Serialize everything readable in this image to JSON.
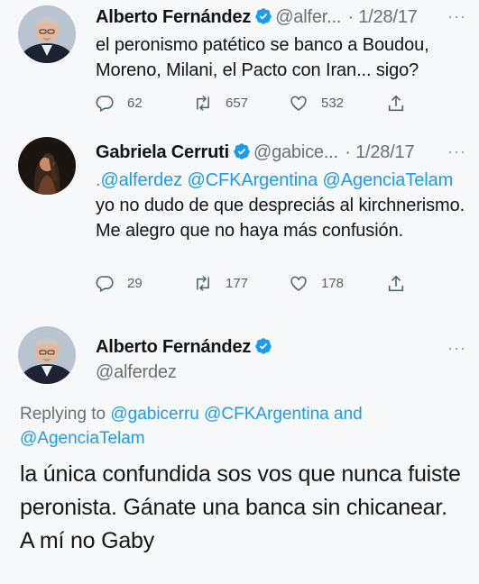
{
  "tweets": [
    {
      "name": "Alberto Fernández",
      "handle": "@alfer...",
      "date": "· 1/28/17",
      "more": "···",
      "text": "el peronismo patético se banco a Boudou, Moreno, Milani, el Pacto con Iran... sigo?",
      "reply_count": "62",
      "retweet_count": "657",
      "like_count": "532"
    },
    {
      "name": "Gabriela Cerruti",
      "handle": "@gabice...",
      "date": "· 1/28/17",
      "more": "···",
      "mentions": ".@alferdez @CFKArgentina @AgenciaTelam",
      "text": "yo no dudo de que despreciás al kirchnerismo. Me alegro que no haya más confusión.",
      "reply_count": "29",
      "retweet_count": "177",
      "like_count": "178"
    },
    {
      "name": "Alberto Fernández",
      "handle": "@alferdez",
      "more": "···",
      "replying_prefix": "Replying to",
      "replying_to_1": "@gabicerru @CFKArgentina",
      "replying_and": "and",
      "replying_to_2": "@AgenciaTelam",
      "text": "la única confundida sos vos que nunca fuiste peronista. Gánate una banca sin chicanear. A mí no Gaby"
    }
  ],
  "colors": {
    "link": "#1d9bf0",
    "verified": "#1d9bf0",
    "muted": "#536471",
    "text": "#0f1419"
  },
  "icons": [
    "reply-icon",
    "retweet-icon",
    "like-icon",
    "share-icon",
    "verified-badge-icon",
    "more-icon"
  ]
}
